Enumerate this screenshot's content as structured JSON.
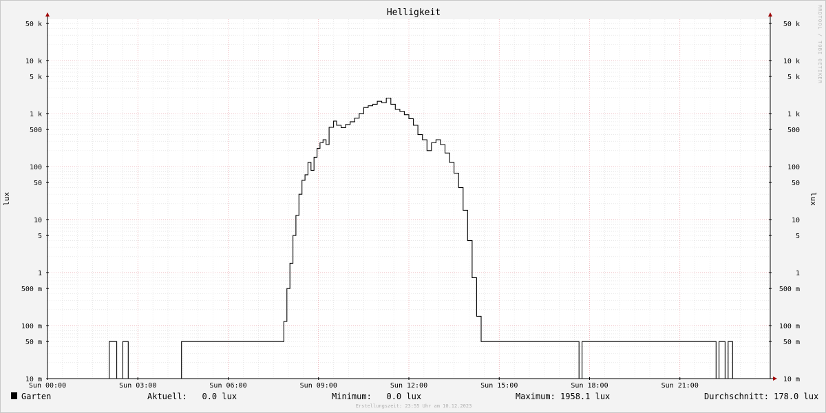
{
  "chart_data": {
    "type": "line",
    "title": "Helligkeit",
    "ylabel": "lux",
    "y_scale": "log",
    "ylim": [
      0.01,
      60000
    ],
    "xlim": [
      0,
      24
    ],
    "x_unit": "hours",
    "grid": true,
    "y_ticks": [
      {
        "v": 0.01,
        "label": "10 m"
      },
      {
        "v": 0.05,
        "label": "50 m"
      },
      {
        "v": 0.1,
        "label": "100 m"
      },
      {
        "v": 0.5,
        "label": "500 m"
      },
      {
        "v": 1,
        "label": "1"
      },
      {
        "v": 5,
        "label": "5"
      },
      {
        "v": 10,
        "label": "10"
      },
      {
        "v": 50,
        "label": "50"
      },
      {
        "v": 100,
        "label": "100"
      },
      {
        "v": 500,
        "label": "500"
      },
      {
        "v": 1000,
        "label": "1 k"
      },
      {
        "v": 5000,
        "label": "5 k"
      },
      {
        "v": 10000,
        "label": "10 k"
      },
      {
        "v": 50000,
        "label": "50 k"
      }
    ],
    "x_ticks": [
      {
        "v": 0,
        "label": "Sun 00:00"
      },
      {
        "v": 3,
        "label": "Sun 03:00"
      },
      {
        "v": 6,
        "label": "Sun 06:00"
      },
      {
        "v": 9,
        "label": "Sun 09:00"
      },
      {
        "v": 12,
        "label": "Sun 12:00"
      },
      {
        "v": 15,
        "label": "Sun 15:00"
      },
      {
        "v": 18,
        "label": "Sun 18:00"
      },
      {
        "v": 21,
        "label": "Sun 21:00"
      }
    ],
    "series": [
      {
        "name": "Garten",
        "color": "#000000",
        "x": [
          0,
          2.05,
          2.05,
          2.3,
          2.3,
          2.5,
          2.5,
          2.68,
          2.68,
          4.45,
          4.45,
          7.75,
          7.85,
          7.95,
          8.05,
          8.15,
          8.25,
          8.35,
          8.45,
          8.55,
          8.65,
          8.75,
          8.85,
          8.95,
          9.05,
          9.15,
          9.25,
          9.35,
          9.5,
          9.6,
          9.75,
          9.9,
          10.05,
          10.2,
          10.35,
          10.5,
          10.65,
          10.8,
          10.95,
          11.1,
          11.25,
          11.4,
          11.55,
          11.7,
          11.85,
          12.0,
          12.15,
          12.3,
          12.45,
          12.6,
          12.75,
          12.9,
          13.05,
          13.2,
          13.35,
          13.5,
          13.65,
          13.8,
          13.95,
          14.1,
          14.25,
          14.4,
          14.55,
          14.7,
          14.85,
          15.0,
          15.15,
          15.3,
          15.45,
          15.6,
          15.75,
          15.9,
          16.05,
          16.2,
          16.35,
          16.5,
          16.65,
          16.8,
          16.95,
          17.05,
          17.2,
          17.5,
          17.65,
          17.65,
          17.75,
          17.75,
          22.2,
          22.2,
          22.3,
          22.3,
          22.5,
          22.5,
          22.6,
          22.6,
          22.75,
          22.75,
          24
        ],
        "y": [
          0.01,
          0.01,
          0.05,
          0.05,
          0.01,
          0.01,
          0.05,
          0.05,
          0.01,
          0.01,
          0.05,
          0.05,
          0.12,
          0.5,
          1.5,
          5,
          12,
          30,
          55,
          70,
          120,
          85,
          150,
          220,
          280,
          320,
          260,
          550,
          720,
          600,
          540,
          620,
          700,
          820,
          1000,
          1300,
          1400,
          1500,
          1700,
          1600,
          1958,
          1500,
          1200,
          1100,
          950,
          800,
          600,
          400,
          320,
          200,
          280,
          320,
          260,
          180,
          120,
          75,
          40,
          15,
          4,
          0.8,
          0.15,
          0.05,
          0.05,
          0.05,
          0.05,
          0.05,
          0.05,
          0.05,
          0.05,
          0.05,
          0.05,
          0.05,
          0.05,
          0.05,
          0.05,
          0.05,
          0.05,
          0.05,
          0.05,
          0.05,
          0.05,
          0.05,
          0.05,
          0.01,
          0.01,
          0.05,
          0.05,
          0.01,
          0.01,
          0.05,
          0.05,
          0.01,
          0.01,
          0.05,
          0.05,
          0.01,
          0.01
        ]
      }
    ]
  },
  "axis": {
    "ylabel_left": "lux",
    "ylabel_right": "lux"
  },
  "watermark": "RRDTOOL / TOBI OETIKER",
  "legend": {
    "series_name": "Garten",
    "swatch_color": "#000000",
    "aktuell": "Aktuell:   0.0 lux",
    "minimum": "Minimum:   0.0 lux",
    "maximum": "Maximum: 1958.1 lux",
    "durchschnitt": "Durchschnitt: 178.0 lux"
  },
  "footer": "Erstellungszeit: 23:55 Uhr am 10.12.2023"
}
